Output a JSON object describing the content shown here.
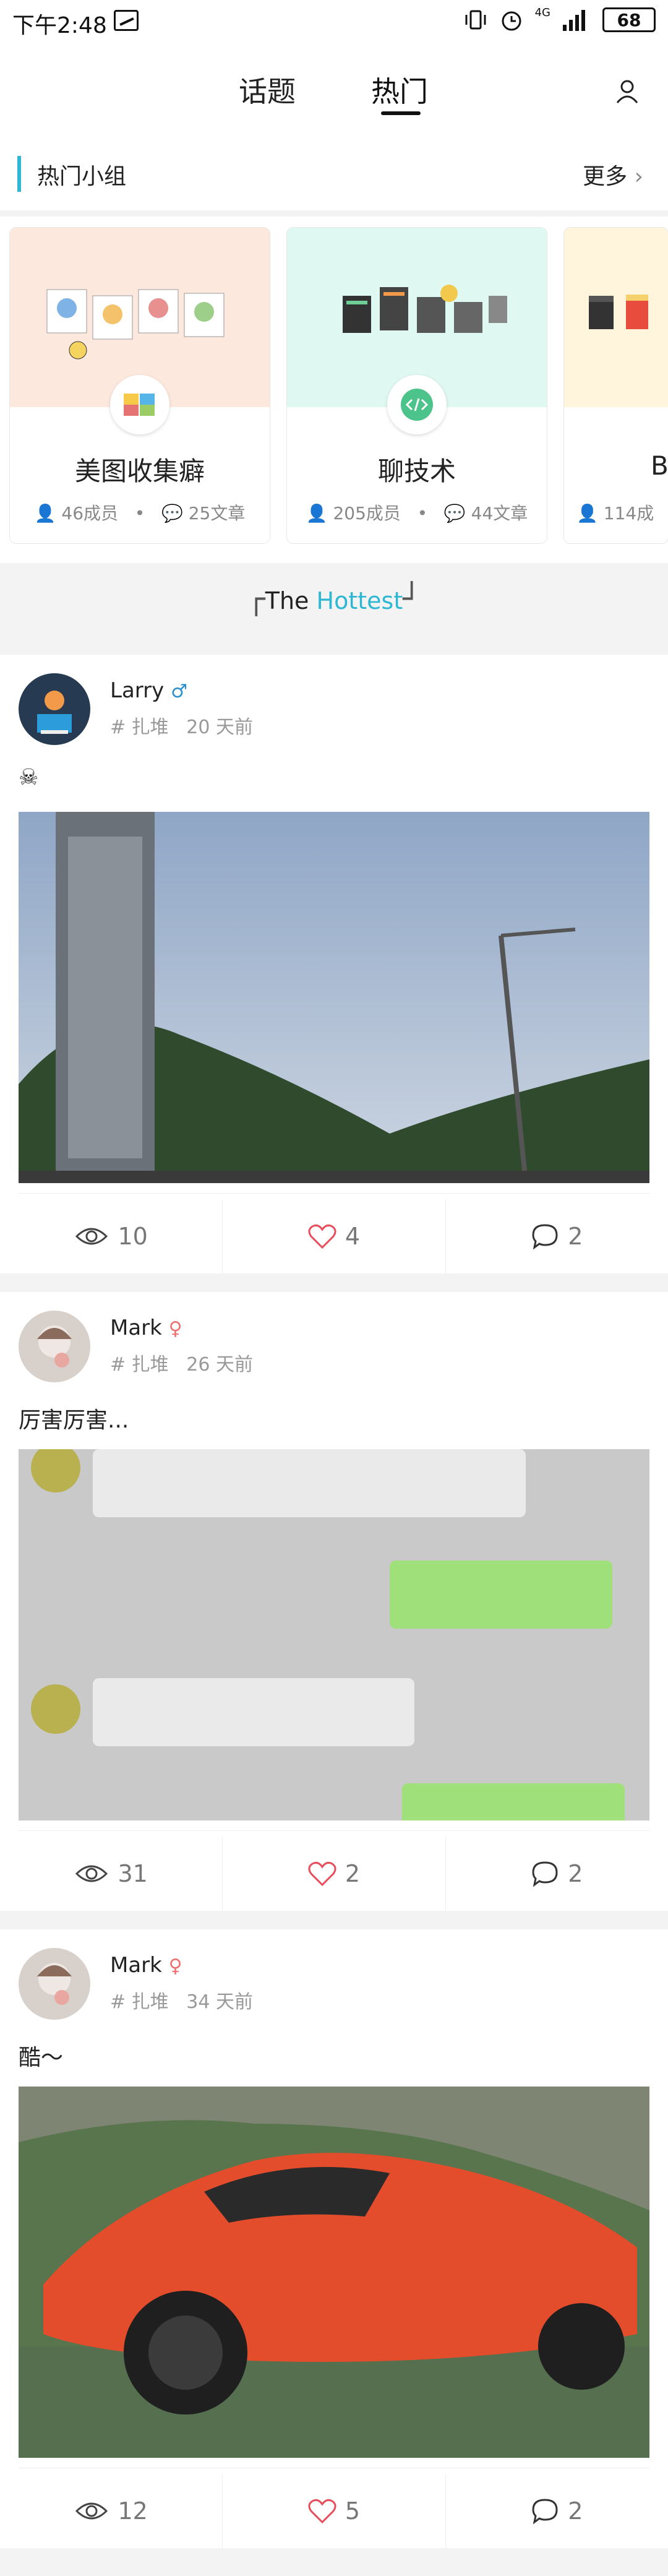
{
  "status_bar": {
    "time": "下午2:48",
    "network": "4G",
    "battery": "68"
  },
  "header": {
    "tabs": [
      {
        "label": "话题"
      },
      {
        "label": "热门"
      }
    ],
    "active_tab": 1
  },
  "hot_groups": {
    "title": "热门小组",
    "more_label": "更多",
    "cards": [
      {
        "title": "美图收集癖",
        "members": "46成员",
        "posts": "25文章"
      },
      {
        "title": "聊技术",
        "members": "205成员",
        "posts": "44文章"
      },
      {
        "title": "B",
        "members": "114成",
        "posts": ""
      }
    ]
  },
  "hottest": {
    "prefix": "The ",
    "accent": "Hottest"
  },
  "posts": [
    {
      "author": "Larry",
      "gender": "♂",
      "group": "# 扎堆",
      "time": "20 天前",
      "text": "☠",
      "views": "10",
      "likes": "4",
      "comments": "2"
    },
    {
      "author": "Mark",
      "gender": "♀",
      "group": "# 扎堆",
      "time": "26 天前",
      "text": "厉害厉害...",
      "views": "31",
      "likes": "2",
      "comments": "2"
    },
    {
      "author": "Mark",
      "gender": "♀",
      "group": "# 扎堆",
      "time": "34 天前",
      "text": "酷～",
      "views": "12",
      "likes": "5",
      "comments": "2"
    }
  ],
  "colors": {
    "accent": "#2db7d2",
    "like": "#e74d5a",
    "male": "#2a8fd0",
    "female": "#f07070"
  }
}
